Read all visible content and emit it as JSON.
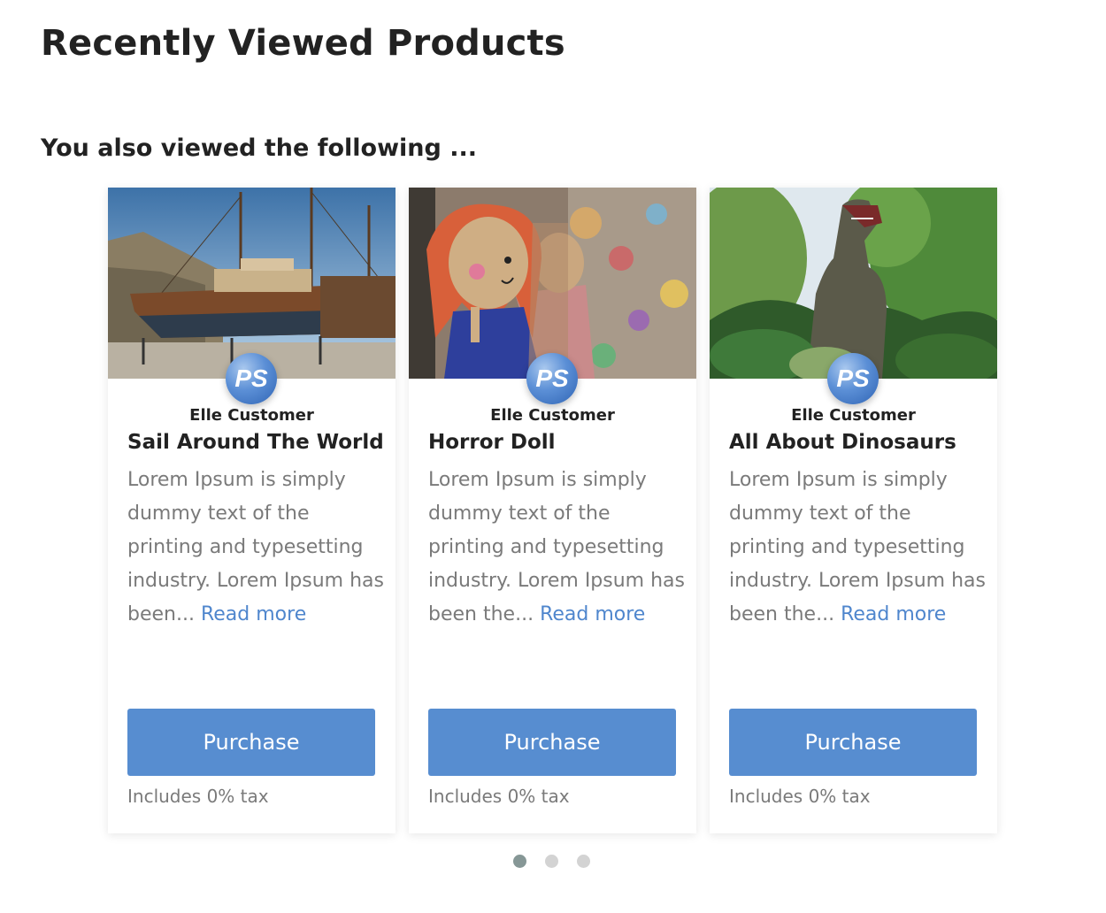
{
  "page": {
    "title": "Recently Viewed Products",
    "subtitle": "You also viewed the following ..."
  },
  "products": [
    {
      "image": "sailing-ship-photo",
      "author": "Elle Customer",
      "title": "Sail Around The World",
      "description": "Lorem Ipsum is simply dummy text of the printing and typesetting industry. Lorem Ipsum has been...",
      "read_more": "Read more",
      "button": "Purchase",
      "tax": "Includes 0% tax"
    },
    {
      "image": "crochet-dolls-photo",
      "author": "Elle Customer",
      "title": "Horror Doll",
      "description": "Lorem Ipsum is simply dummy text of the printing and typesetting industry. Lorem Ipsum has been the...",
      "read_more": "Read more",
      "button": "Purchase",
      "tax": "Includes 0% tax"
    },
    {
      "image": "dinosaur-statue-photo",
      "author": "Elle Customer",
      "title": "All About Dinosaurs",
      "description": "Lorem Ipsum is simply dummy text of the printing and typesetting industry. Lorem Ipsum has been the...",
      "read_more": "Read more",
      "button": "Purchase",
      "tax": "Includes 0% tax"
    }
  ],
  "avatar_logo": "PS",
  "carousel": {
    "pages": 3,
    "active_page": 1
  },
  "colors": {
    "accent": "#578dd0",
    "link": "#4f86cd",
    "dot_active": "#869796",
    "dot_inactive": "#d3d3d3"
  }
}
